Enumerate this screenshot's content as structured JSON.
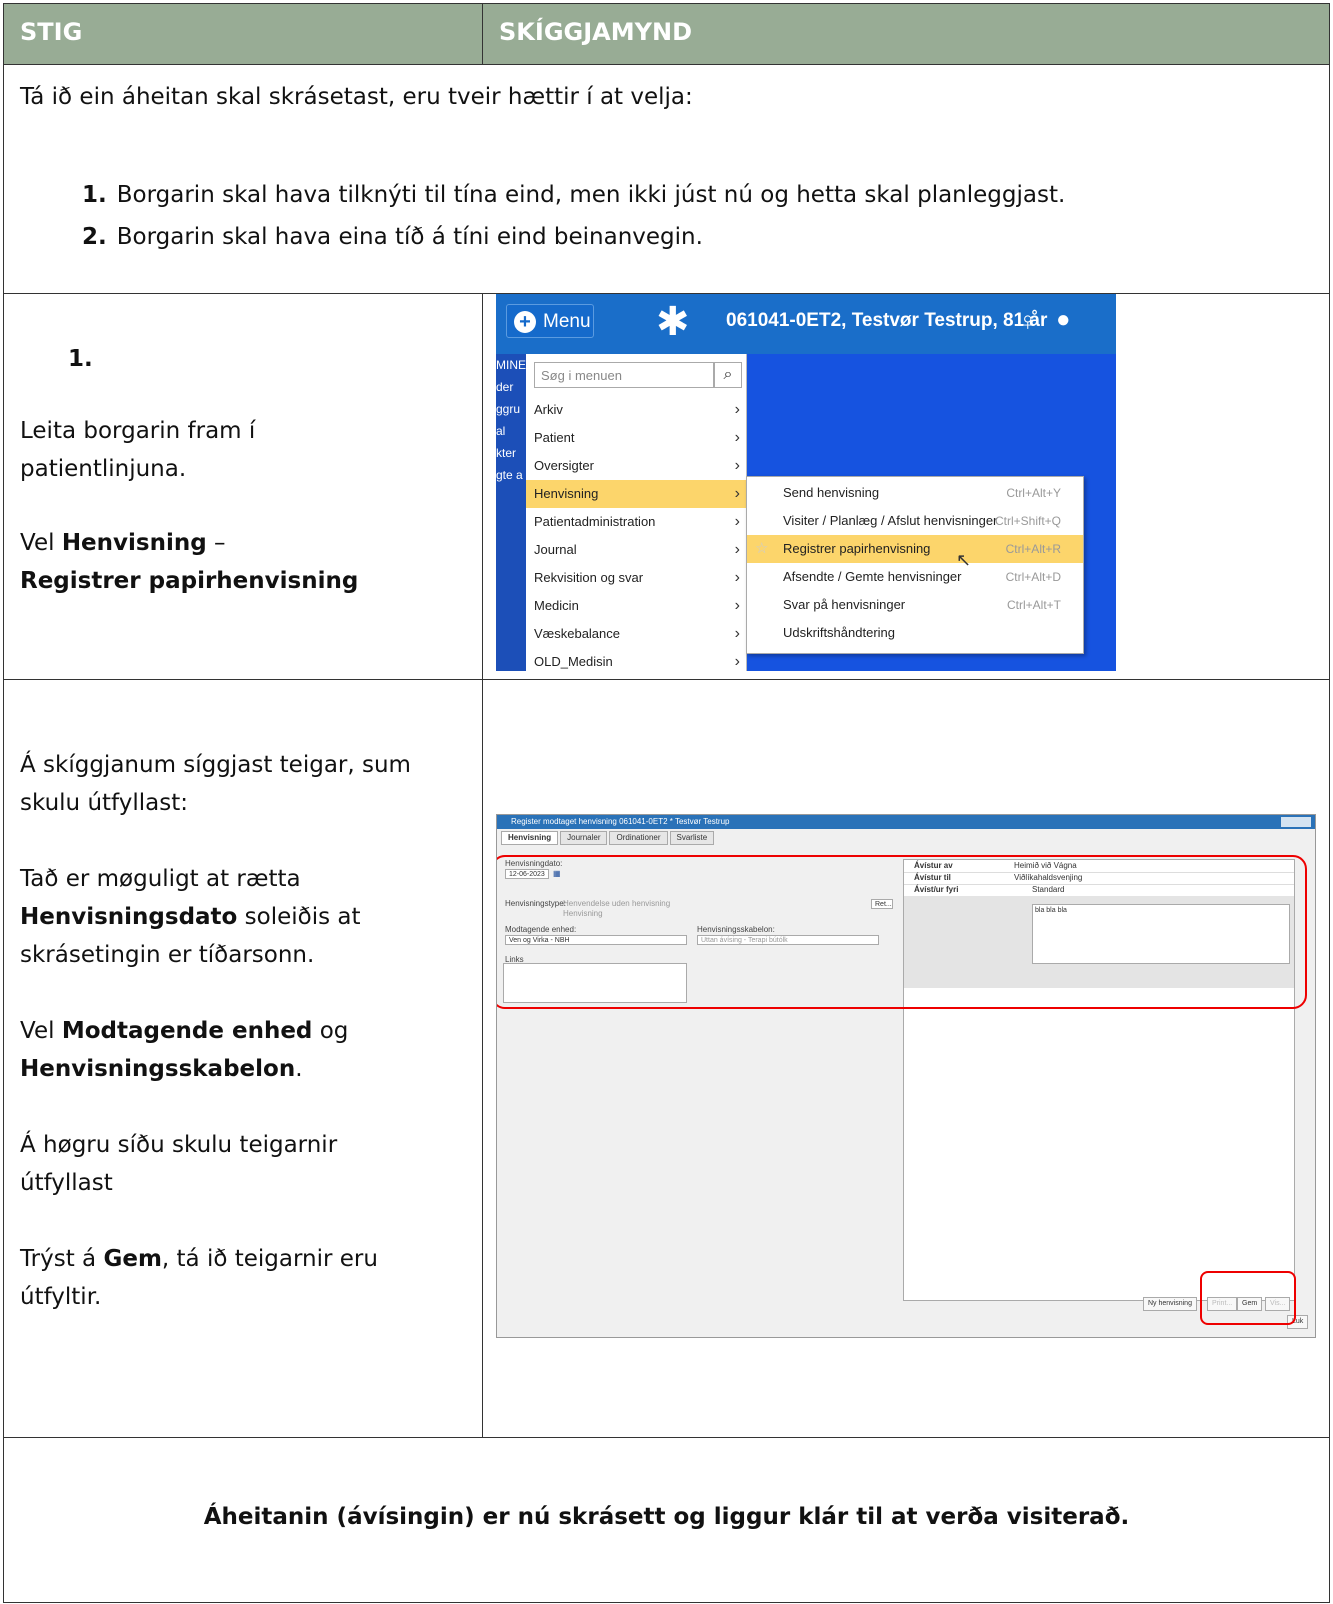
{
  "header": {
    "col1": "STIG",
    "col2": "SKÍGGJAMYND"
  },
  "intro": {
    "text": "Tá ið ein áheitan skal skrásetast, eru tveir hættir í at velja:",
    "items": [
      {
        "num": "1.",
        "text": "Borgarin skal hava tilknýti til tína eind, men ikki júst nú og hetta skal planleggjast."
      },
      {
        "num": "2.",
        "text": "Borgarin skal hava eina tíð á tíni eind beinanvegin."
      }
    ]
  },
  "step1": {
    "num": "1.",
    "line1": "Leita borgarin fram í",
    "line2": "patientlinjuna.",
    "vel": "Vel ",
    "b1": "Henvisning",
    "dash": " –",
    "b2": "Registrer papirhenvisning"
  },
  "step2": {
    "p1a": "Á skíggjanum síggjast teigar, sum",
    "p1b": "skulu útfyllast:",
    "p2a": "Tað er møguligt at rætta",
    "p2b": "Henvisningsdato",
    "p2c": " soleiðis at",
    "p2d": "skrásetingin er tíðarsonn.",
    "p3a": "Vel ",
    "p3b": "Modtagende enhed",
    "p3c": " og",
    "p3d": "Henvisningsskabelon",
    "p3e": ".",
    "p4a": "Á høgru síðu skulu teigarnir",
    "p4b": "útfyllast",
    "p5a": "Trýst á ",
    "p5b": "Gem",
    "p5c": ", tá ið teigarnir eru",
    "p5d": "útfyltir."
  },
  "final": "Áheitanin (ávísingin) er nú skrásett og liggur klár til at verða visiterað.",
  "shot1": {
    "menu_label": "Menu",
    "patient": "061041-0ET2, Testvør Testrup, 81 år",
    "side": [
      "MINE",
      "der",
      "ggru",
      "al",
      "kter",
      "gte a"
    ],
    "search_placeholder": "Søg i menuen",
    "items": [
      "Arkiv",
      "Patient",
      "Oversigter",
      "Henvisning",
      "Patientadministration",
      "Journal",
      "Rekvisition og svar",
      "Medicin",
      "Væskebalance",
      "OLD_Medisin"
    ],
    "submenu": [
      {
        "label": "Send henvisning",
        "shortcut": "Ctrl+Alt+Y"
      },
      {
        "label": "Visiter / Planlæg / Afslut henvisninger",
        "shortcut": "Ctrl+Shift+Q"
      },
      {
        "label": "Registrer papirhenvisning",
        "shortcut": "Ctrl+Alt+R"
      },
      {
        "label": "Afsendte / Gemte henvisninger",
        "shortcut": "Ctrl+Alt+D"
      },
      {
        "label": "Svar på henvisninger",
        "shortcut": "Ctrl+Alt+T"
      },
      {
        "label": "Udskriftshåndtering",
        "shortcut": ""
      }
    ]
  },
  "shot2": {
    "title": "Register modtaget henvisning 061041-0ET2 * Testvør Testrup",
    "tabs": [
      "Henvisning",
      "Journaler",
      "Ordinationer",
      "Svarliste"
    ],
    "dato_label": "Henvisningdato:",
    "dato_value": "12-06-2023",
    "type_label": "Henvisningstype:",
    "type_opt1": "Henvendelse uden henvisning",
    "type_opt2": "Henvisning",
    "ret": "Ret...",
    "enhed_label": "Modtagende enhed:",
    "enhed_value": "Ven og Virka - NBH",
    "skabelon_label": "Henvisningsskabelon:",
    "skabelon_value": "Uttan ávísing - Terapi bútólk",
    "links": "Links",
    "avistur_av": "Ávístur av",
    "avistur_av_val": "Heimið við Vágna",
    "avistur_til": "Ávístur til",
    "avistur_til_val": "Viðlíkahaldsvenjing",
    "avist_fyri": "Ávíst/ur fyri",
    "standard": "Standard",
    "text_val": "bla bla bla",
    "btn_ny": "Ny henvisning",
    "btn_print": "Print...",
    "btn_gem": "Gem",
    "btn_vis": "Vis...",
    "btn_luk": "Luk"
  }
}
